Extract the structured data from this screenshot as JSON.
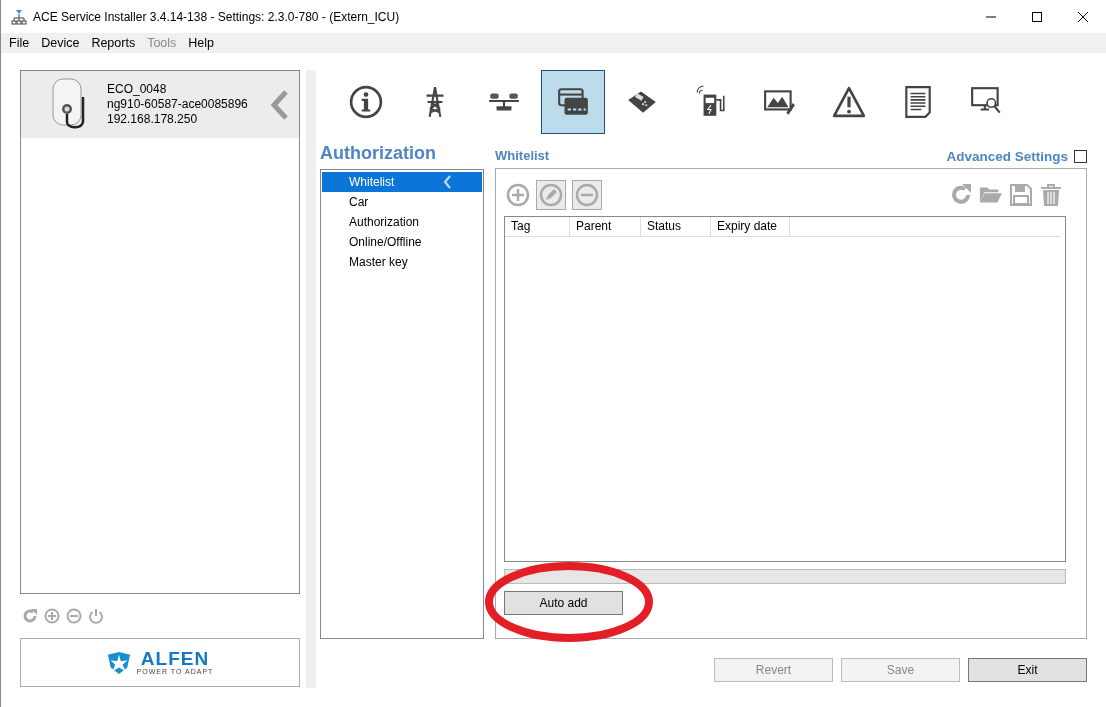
{
  "window": {
    "title": "ACE Service Installer 3.4.14-138 - Settings: 2.3.0-780 -  (Extern_ICU)"
  },
  "menu": [
    {
      "label": "File",
      "disabled": false
    },
    {
      "label": "Device",
      "disabled": false
    },
    {
      "label": "Reports",
      "disabled": false
    },
    {
      "label": "Tools",
      "disabled": true
    },
    {
      "label": "Help",
      "disabled": false
    }
  ],
  "logo": {
    "wordmark": "ALFEN",
    "tagline": "POWER TO ADAPT"
  },
  "progress": {
    "level": 0
  },
  "device": {
    "name": "ECO_0048",
    "serial": "ng910-60587-ace0085896",
    "ip": "192.168.178.250",
    "selected": true
  },
  "category_tabs": [
    {
      "kind": "info",
      "selected": false
    },
    {
      "kind": "power",
      "selected": false
    },
    {
      "kind": "balance",
      "selected": false
    },
    {
      "kind": "cards",
      "selected": true
    },
    {
      "kind": "terminal",
      "selected": false
    },
    {
      "kind": "charger",
      "selected": false
    },
    {
      "kind": "image",
      "selected": false
    },
    {
      "kind": "warning",
      "selected": false
    },
    {
      "kind": "document",
      "selected": false
    },
    {
      "kind": "monitor",
      "selected": false
    }
  ],
  "section_title": "Authorization",
  "sub_items": [
    {
      "label": "Whitelist",
      "selected": true
    },
    {
      "label": "Car",
      "selected": false
    },
    {
      "label": "Authorization",
      "selected": false
    },
    {
      "label": "Online/Offline",
      "selected": false
    },
    {
      "label": "Master key",
      "selected": false
    }
  ],
  "panel_title": "Whitelist",
  "advanced_settings": {
    "label": "Advanced Settings",
    "checked": false
  },
  "table": {
    "columns": [
      "Tag",
      "Parent",
      "Status",
      "Expiry date"
    ]
  },
  "auto_add_button": "Auto add",
  "footer_buttons": [
    {
      "label": "Revert",
      "disabled": true
    },
    {
      "label": "Save",
      "disabled": true
    },
    {
      "label": "Exit",
      "disabled": false
    }
  ]
}
